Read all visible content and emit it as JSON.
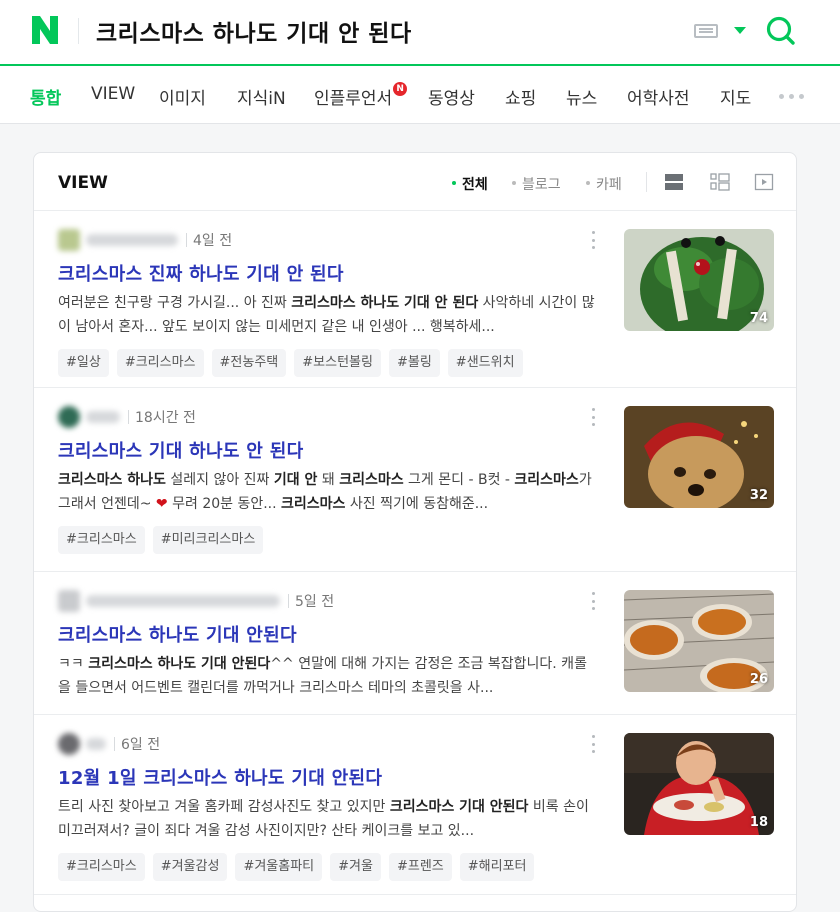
{
  "header": {
    "logo_letter": "N",
    "query": "크리스마스 하나도 기대 안 된다",
    "brand_color": "#03c75a"
  },
  "tabs": [
    {
      "label": "통합",
      "active": true
    },
    {
      "label": "VIEW"
    },
    {
      "label": "이미지"
    },
    {
      "label": "지식iN"
    },
    {
      "label": "인플루언서",
      "badge": "N"
    },
    {
      "label": "동영상"
    },
    {
      "label": "쇼핑"
    },
    {
      "label": "뉴스"
    },
    {
      "label": "어학사전"
    },
    {
      "label": "지도"
    }
  ],
  "view_panel": {
    "title": "VIEW",
    "filters": [
      {
        "label": "전체",
        "active": true
      },
      {
        "label": "블로그"
      },
      {
        "label": "카페"
      }
    ],
    "icons": [
      "list-view-icon",
      "card-view-icon",
      "video-view-icon"
    ]
  },
  "results": [
    {
      "time": "4일 전",
      "title": "크리스마스 진짜 하나도 기대 안 된다",
      "desc_html": "여러분은 친구랑 구경 가시길... 아 진짜 <b>크리스마스 하나도 기대 안 된다</b> 사악하네 시간이 많이 남아서 혼자... 앞도 보이지 않는 미세먼지 같은 내 인생아 ... 행복하세...",
      "tags": [
        "#일상",
        "#크리스마스",
        "#전농주택",
        "#보스턴볼링",
        "#볼링",
        "#샌드위치"
      ],
      "image_count": "74",
      "thumb_desc": "green plush toy"
    },
    {
      "time": "18시간 전",
      "title": "크리스마스 기대 하나도 안 된다",
      "desc_html": "<b>크리스마스 하나도</b> 설레지 않아 진짜 <b>기대 안</b> 돼 <b>크리스마스</b> 그게 몬디 - B컷 - <b>크리스마스</b>가 그래서 언젠데~ ❤ 무려 20분 동안... <b>크리스마스</b> 사진 찍기에 동참해준...",
      "tags": [
        "#크리스마스",
        "#미리크리스마스"
      ],
      "image_count": "32",
      "thumb_desc": "dog in santa hat"
    },
    {
      "time": "5일 전",
      "title": "크리스마스 하나도 기대 안된다",
      "desc_html": "ㅋㅋ <b>크리스마스 하나도 기대 안된다</b>^^ 연말에 대해 가지는 감정은 조금 복잡합니다. 캐롤을 들으면서 어드벤트 캘린더를 까먹거나 크리스마스 테마의 초콜릿을 사...",
      "tags": [],
      "image_count": "26",
      "thumb_desc": "pies on rack"
    },
    {
      "time": "6일 전",
      "title": "12월 1일 크리스마스 하나도 기대 안된다",
      "desc_html": "트리 사진 찾아보고 겨울 홈카페 감성사진도 찾고 있지만 <b>크리스마스 기대 안된다</b> 비록 손이 미끄러져서? 글이 죄다 겨울 감성 사진이지만? 산타 케이크를 보고 있...",
      "tags": [
        "#크리스마스",
        "#겨울감성",
        "#겨울홈파티",
        "#겨울",
        "#프렌즈",
        "#해리포터"
      ],
      "image_count": "18",
      "thumb_desc": "child eating cake"
    }
  ]
}
